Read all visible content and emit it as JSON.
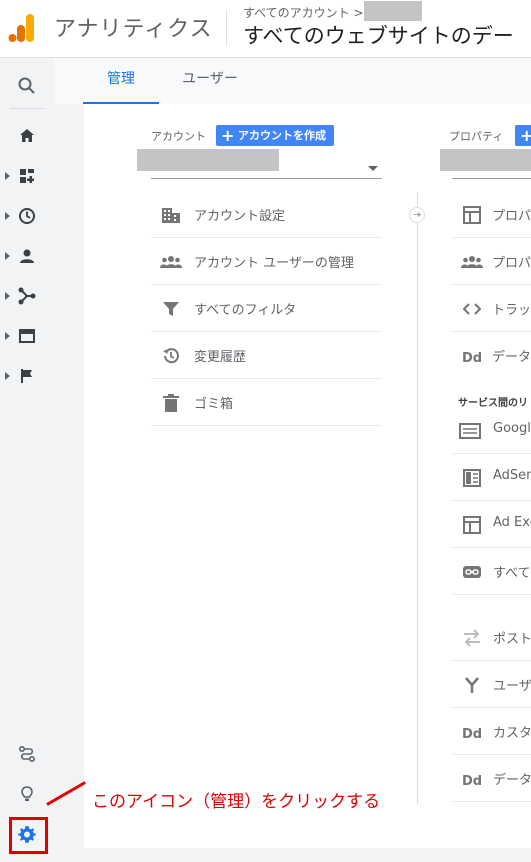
{
  "header": {
    "app_title": "アナリティクス",
    "breadcrumb": "すべてのアカウント >",
    "view_title": "すべてのウェブサイトのデー"
  },
  "tabs": [
    {
      "label": "管理",
      "active": true
    },
    {
      "label": "ユーザー",
      "active": false
    }
  ],
  "rail": {
    "items": [
      "search-icon",
      "home-icon",
      "dashboard-icon",
      "clock-icon",
      "person-icon",
      "acquisition-icon",
      "behavior-icon",
      "flag-icon",
      "attribution-icon",
      "lightbulb-icon",
      "gear-icon"
    ]
  },
  "account_column": {
    "label": "アカウント",
    "create_button": "アカウントを作成",
    "items": [
      {
        "icon": "building-icon",
        "label": "アカウント設定"
      },
      {
        "icon": "people-icon",
        "label": "アカウント ユーザーの管理"
      },
      {
        "icon": "filter-icon",
        "label": "すべてのフィルタ"
      },
      {
        "icon": "history-icon",
        "label": "変更履歴"
      },
      {
        "icon": "trash-icon",
        "label": "ゴミ箱"
      }
    ]
  },
  "property_column": {
    "label": "プロパティ",
    "create_button": "",
    "items": [
      {
        "icon": "square-icon",
        "label": "プロパ"
      },
      {
        "icon": "people-icon",
        "label": "プロパ"
      },
      {
        "icon": "code-icon",
        "label": "トラッ"
      },
      {
        "icon": "dd-icon",
        "label": "データ"
      }
    ],
    "section_head": "サービス間のリ",
    "link_items": [
      {
        "icon": "google-ads-icon",
        "label": "Google"
      },
      {
        "icon": "adsense-icon",
        "label": "AdSen"
      },
      {
        "icon": "square-icon",
        "label": "Ad Exc"
      },
      {
        "icon": "link-icon",
        "label": "すべて"
      }
    ],
    "more_items": [
      {
        "icon": "postback-icon",
        "label": "ポスト"
      },
      {
        "icon": "fork-icon",
        "label": "ユーザ"
      },
      {
        "icon": "dd-icon",
        "label": "カスタ"
      },
      {
        "icon": "dd-icon",
        "label": "データ"
      }
    ]
  },
  "annotation": {
    "text": "このアイコン（管理）をクリックする",
    "color": "#e00000"
  },
  "colors": {
    "accent": "#1a73e8",
    "button": "#4285f4",
    "logo_orange": "#f9ab00",
    "logo_dark_orange": "#e37400"
  }
}
